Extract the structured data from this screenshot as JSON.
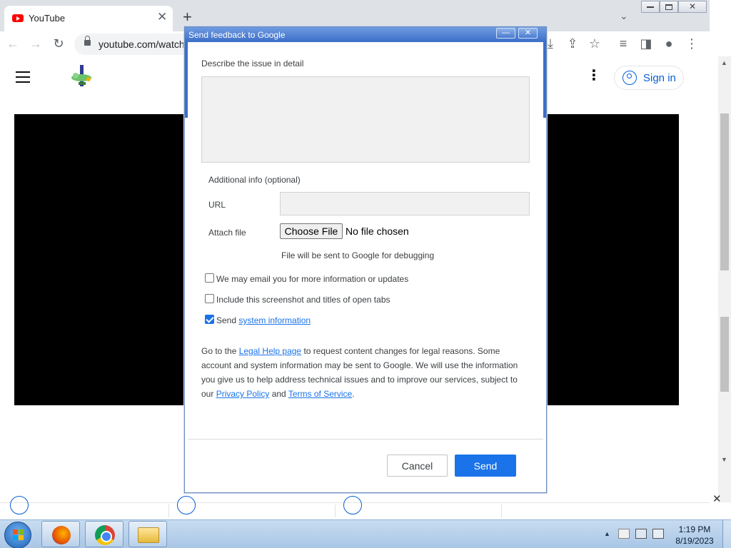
{
  "browser": {
    "tab_title": "YouTube",
    "tab_close": "✕",
    "new_tab": "+",
    "tab_search": "⌄",
    "window_controls": {
      "minimize": "▭",
      "maximize": "▣",
      "close": "✕"
    },
    "nav": {
      "back": "←",
      "forward": "→",
      "reload": "↻"
    },
    "url": "youtube.com/watch",
    "toolbar_icons": {
      "download": "⤓",
      "share": "⇪",
      "bookmark": "☆",
      "media": "≡",
      "sidepanel": "◨",
      "profile": "●",
      "menu": "⋮"
    }
  },
  "youtube": {
    "menu_icon": "hamburger-icon",
    "more_icon": "⋮",
    "signin_label": "Sign in"
  },
  "dialog": {
    "title": "Send feedback to Google",
    "minimize": "—",
    "close": "✕",
    "describe_label": "Describe the issue in detail",
    "description_value": "",
    "additional_info_label": "Additional info (optional)",
    "url_label": "URL",
    "url_value": "",
    "attach_label": "Attach file",
    "choose_file_label": "Choose File",
    "no_file_label": "No file chosen",
    "file_note": "File will be sent to Google for debugging",
    "checkbox_email_label": "We may email you for more information or updates",
    "checkbox_email_checked": false,
    "checkbox_screenshot_label": "Include this screenshot and titles of open tabs",
    "checkbox_screenshot_checked": false,
    "checkbox_sysinfo_prefix": "Send",
    "checkbox_sysinfo_link": "system information",
    "checkbox_sysinfo_checked": true,
    "legal": {
      "t1": "Go to the ",
      "link1": "Legal Help page",
      "t2": " to request content changes for legal reasons. Some account and system information may be sent to Google. We will use the information you give us to help address technical issues and to improve our services, subject to our ",
      "link2": "Privacy Policy",
      "t3": " and ",
      "link3": "Terms of Service",
      "t4": "."
    },
    "cancel_label": "Cancel",
    "send_label": "Send"
  },
  "taskbar": {
    "time": "1:19 PM",
    "date": "8/19/2023",
    "tray_arrow": "▲",
    "apps": [
      "firefox-icon",
      "chrome-icon",
      "file-explorer-icon"
    ]
  },
  "colors": {
    "accent": "#1a73e8",
    "youtube_red": "#ff0000",
    "dialog_title": "#3c6fc9",
    "taskbar": "#a9c6e6"
  }
}
